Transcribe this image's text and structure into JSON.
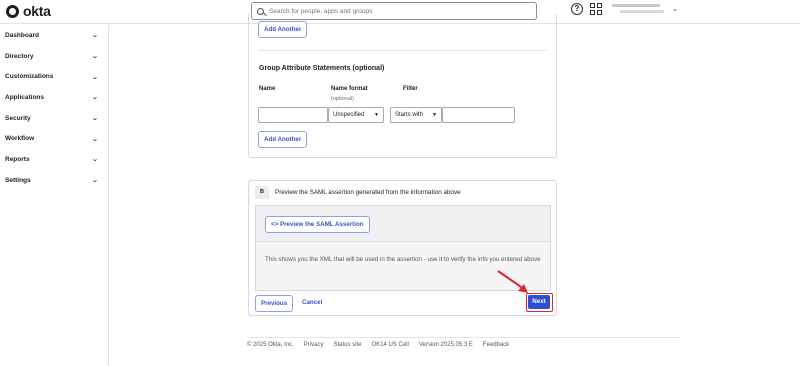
{
  "header": {
    "brand": "okta",
    "search_placeholder": "Search for people, apps and groups",
    "help_glyph": "?"
  },
  "sidebar": {
    "items": [
      {
        "label": "Dashboard"
      },
      {
        "label": "Directory"
      },
      {
        "label": "Customizations"
      },
      {
        "label": "Applications"
      },
      {
        "label": "Security"
      },
      {
        "label": "Workflow"
      },
      {
        "label": "Reports"
      },
      {
        "label": "Settings"
      }
    ]
  },
  "attributes": {
    "add_another_label": "Add Another",
    "group_title": "Group Attribute Statements (optional)",
    "col_name": "Name",
    "col_name_format": "Name format",
    "col_name_format_sub": "(optional)",
    "col_filter": "Filter",
    "name_format_value": "Unspecified",
    "filter_value": "Starts with",
    "add_another_label_2": "Add Another"
  },
  "section_b": {
    "step": "B",
    "title": "Preview the SAML assertion generated from the information above",
    "preview_button": "<> Preview the SAML Assertion",
    "help_text": "This shows you the XML that will be used in the assertion - use it to verify the info you entered above"
  },
  "actions": {
    "previous": "Previous",
    "cancel": "Cancel",
    "next": "Next"
  },
  "footer": {
    "copyright": "© 2025 Okta, Inc.",
    "privacy": "Privacy",
    "status": "Status site",
    "cell": "OK14 US Cell",
    "version": "Version 2025.05.3 E",
    "feedback": "Feedback"
  },
  "colors": {
    "accent": "#2f4fd1",
    "highlight": "#d9262d"
  }
}
